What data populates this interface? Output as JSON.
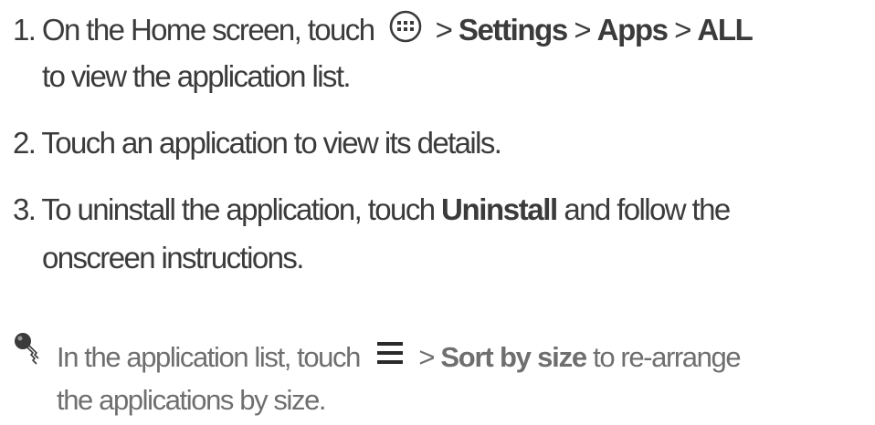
{
  "steps": [
    {
      "number": "1.",
      "line1_pre": "On the Home screen, touch",
      "icon": "apps-launcher-icon",
      "sep1": ">",
      "settings": "Settings",
      "sep2": ">",
      "apps": "Apps",
      "sep3": ">",
      "all": "ALL",
      "line2": "to view the application list."
    },
    {
      "number": "2.",
      "text": "Touch an application to view its details."
    },
    {
      "number": "3.",
      "line1_pre": "To uninstall the application, touch",
      "uninstall": "Uninstall",
      "line1_post": "and follow the",
      "line2": "onscreen instructions."
    }
  ],
  "tip": {
    "icon": "tip-key-icon",
    "pre": "In the application list, touch",
    "menu_icon": "menu-icon",
    "sep": ">",
    "sort": "Sort by size",
    "post": "to re-arrange",
    "line2": "the applications by size."
  },
  "colors": {
    "body_text": "#3b3b3b",
    "tip_text": "#6f6f6f"
  }
}
